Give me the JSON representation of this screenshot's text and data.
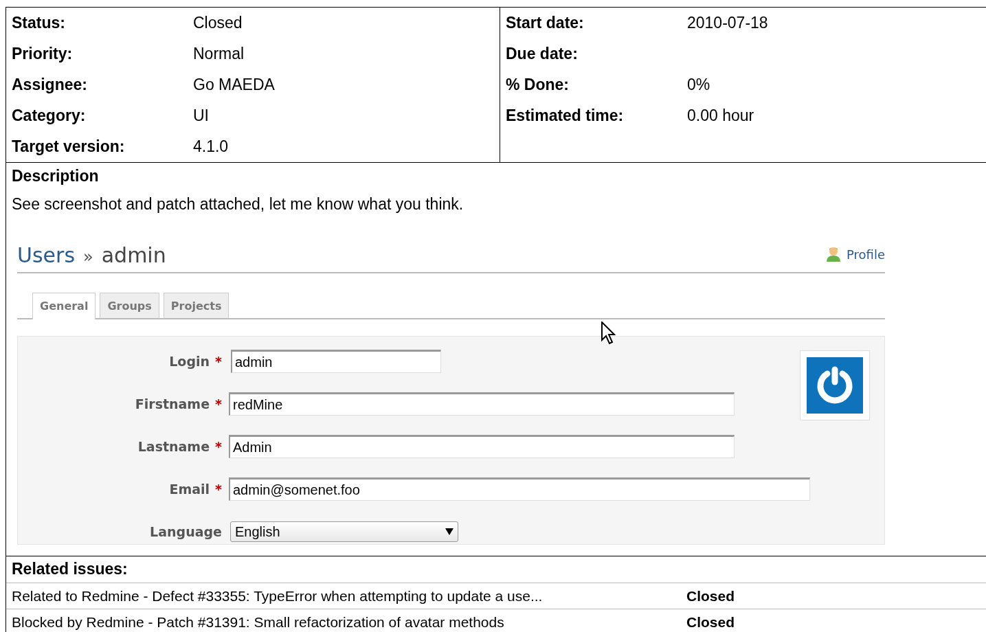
{
  "attributes": {
    "left": [
      {
        "label": "Status:",
        "value": "Closed"
      },
      {
        "label": "Priority:",
        "value": "Normal"
      },
      {
        "label": "Assignee:",
        "value": "Go MAEDA"
      },
      {
        "label": "Category:",
        "value": "UI"
      },
      {
        "label": "Target version:",
        "value": "4.1.0"
      }
    ],
    "right": [
      {
        "label": "Start date:",
        "value": "2010-07-18"
      },
      {
        "label": "Due date:"
      },
      {
        "label": "% Done:",
        "value": "0%"
      },
      {
        "label": "Estimated time:",
        "value": "0.00 hour"
      }
    ]
  },
  "description": {
    "heading": "Description",
    "text": "See screenshot and patch attached, let me know what you think.",
    "screenshot": {
      "breadcrumb_link": "Users",
      "separator": "»",
      "title": "admin",
      "profile_link": "Profile",
      "tabs": [
        {
          "label": "General",
          "selected": true
        },
        {
          "label": "Groups",
          "selected": false
        },
        {
          "label": "Projects",
          "selected": false
        }
      ],
      "fields": [
        {
          "kind": "text",
          "label": "Login",
          "required_mark": "*",
          "value": "admin"
        },
        {
          "kind": "text",
          "label": "Firstname",
          "required_mark": "*",
          "value": "redMine"
        },
        {
          "kind": "text",
          "label": "Lastname",
          "required_mark": "*",
          "value": "Admin"
        },
        {
          "kind": "text",
          "label": "Email",
          "required_mark": "*",
          "value": "admin@somenet.foo"
        },
        {
          "kind": "select",
          "label": "Language",
          "value": "English"
        }
      ]
    }
  },
  "related_issues": {
    "heading": "Related issues:",
    "rows": [
      {
        "text": "Related to Redmine - Defect #33355: TypeError when attempting to update a use...",
        "status": "Closed"
      },
      {
        "text": "Blocked by Redmine - Patch #31391:  Small refactorization of avatar methods",
        "status": "Closed"
      }
    ]
  }
}
